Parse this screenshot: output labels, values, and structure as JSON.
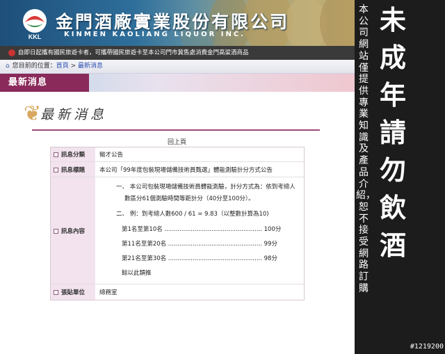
{
  "header": {
    "company_name": "金門酒廠實業股份有限公司",
    "company_english": "KINMEN KAOLIANG LIQUOR INC.",
    "logo_text": "KKL"
  },
  "notice": "自即日起攜有國民旅遊卡者，可攜帶國民旅遊卡至本公司門市冀售處消費金門高粱酒商品",
  "breadcrumb": {
    "prefix": "您目前的位置：",
    "home": "首頁",
    "separator": ">",
    "current": "最新消息"
  },
  "title_tab": "最新消息",
  "section_heading": "最新消息",
  "back_link": "回上頁",
  "info": {
    "category_label": "訊息分類",
    "category_value": "徵才公告",
    "title_label": "訊息標題",
    "title_value": "本公司「99年度包裝現場儲備技術員甄選」體能測驗計分方式公告",
    "content_label": "訊息內容",
    "content": {
      "item1_line1": "一、 本公司包裝現場儲備技術員體能測驗，計分方式為：依到考總人",
      "item1_line2": "數區分61個測驗時間等距計分（40分至100分）。",
      "item2": "二、 例：到考總人數600 / 61 = 9.83（以整數計算為10)",
      "rank1": "第1名至第10名 .................................................... 100分",
      "rank2": "第11名至第20名 .................................................. 99分",
      "rank3": "第21名至第30名 .................................................. 98分",
      "rest": "餘以此類推"
    },
    "unit_label": "張貼單位",
    "unit_value": "總務室"
  },
  "warning": {
    "small_text": "本公司網站僅提供專業知識及產品介紹，恕不接受網路訂購",
    "big_text": "未成年請勿飲酒"
  },
  "serial": "#1219200",
  "colors": {
    "accent": "#8a2a5a",
    "label_bg": "#f2e3ee",
    "side_bg": "#1c1c1c"
  }
}
